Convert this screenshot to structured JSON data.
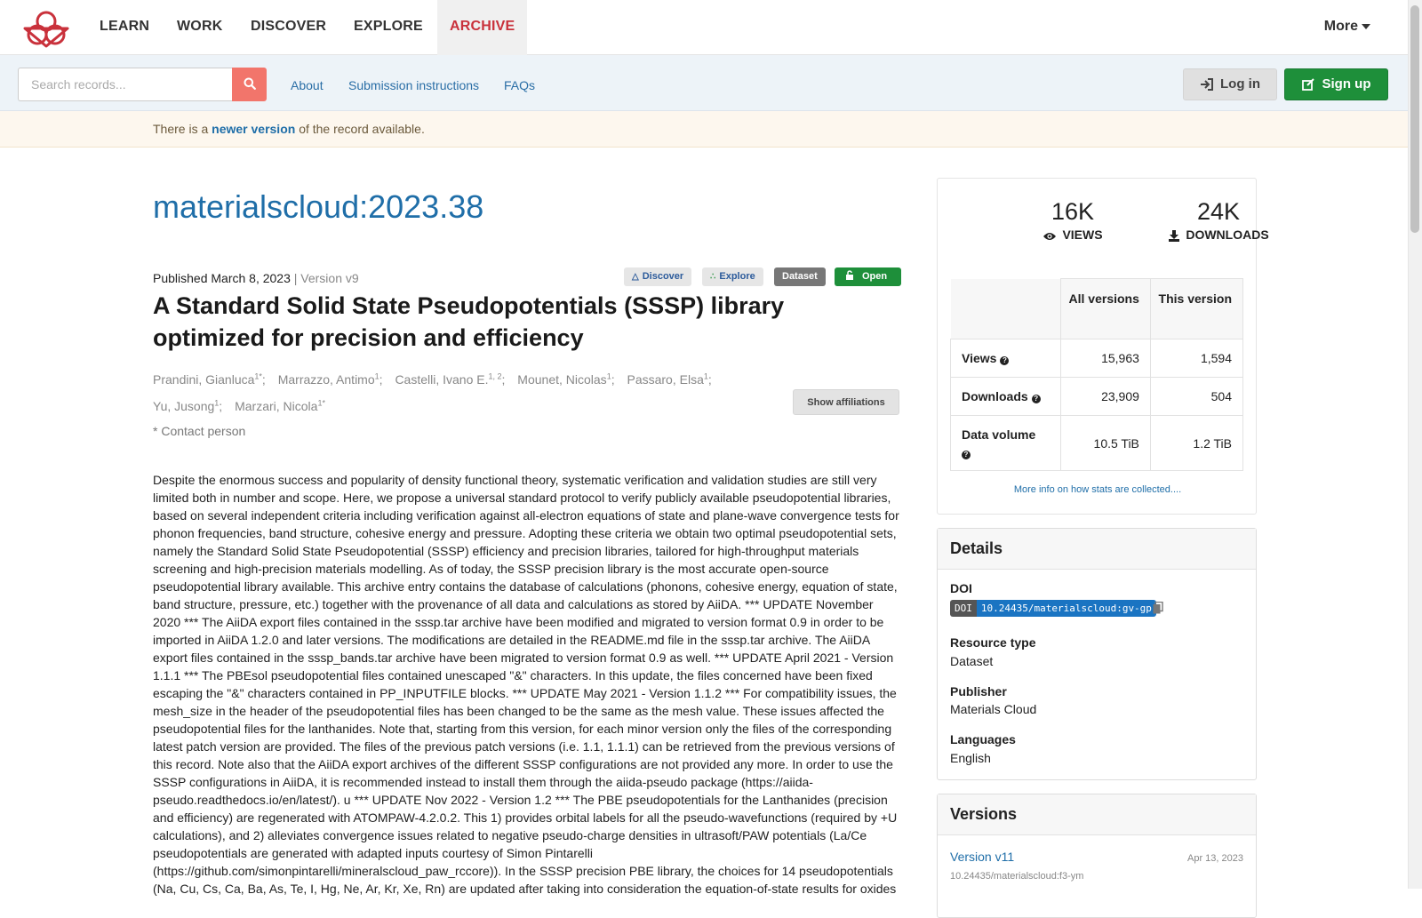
{
  "nav": {
    "items": [
      {
        "label": "LEARN"
      },
      {
        "label": "WORK"
      },
      {
        "label": "DISCOVER"
      },
      {
        "label": "EXPLORE"
      },
      {
        "label": "ARCHIVE"
      }
    ],
    "active": "ARCHIVE",
    "more_label": "More",
    "accent_color": "#c9313b"
  },
  "subbar": {
    "search_placeholder": "Search records...",
    "links": [
      "About",
      "Submission instructions",
      "FAQs"
    ],
    "login_label": "Log in",
    "signup_label": "Sign up"
  },
  "notice": {
    "prefix": "There is a",
    "link": "newer version",
    "suffix": "of the record available."
  },
  "record": {
    "id": "materialscloud:2023.38",
    "published_label": "Published March 8, 2023",
    "version_label": "| Version v9",
    "badges": {
      "discover": "Discover",
      "explore": "Explore",
      "dataset": "Dataset",
      "open": "Open"
    },
    "title": "A Standard Solid State Pseudopotentials (SSSP) library optimized for precision and efficiency",
    "authors": [
      {
        "name": "Prandini, Gianluca",
        "aff": "1*"
      },
      {
        "name": "Marrazzo, Antimo",
        "aff": "1"
      },
      {
        "name": "Castelli, Ivano E.",
        "aff": "1, 2"
      },
      {
        "name": "Mounet, Nicolas",
        "aff": "1"
      },
      {
        "name": "Passaro, Elsa",
        "aff": "1"
      },
      {
        "name": "Yu, Jusong",
        "aff": "1"
      },
      {
        "name": "Marzari, Nicola",
        "aff": "1*"
      }
    ],
    "show_affiliations_label": "Show affiliations",
    "contact_note": "* Contact person",
    "abstract": "Despite the enormous success and popularity of density functional theory, systematic verification and validation studies are still very limited both in number and scope. Here, we propose a universal standard protocol to verify publicly available pseudopotential libraries, based on several independent criteria including verification against all-electron equations of state and plane-wave convergence tests for phonon frequencies, band structure, cohesive energy and pressure. Adopting these criteria we obtain two optimal pseudopotential sets, namely the Standard Solid State Pseudopotential (SSSP) efficiency and precision libraries, tailored for high-throughput materials screening and high-precision materials modelling. As of today, the SSSP precision library is the most accurate open-source pseudopotential library available. This archive entry contains the database of calculations (phonons, cohesive energy, equation of state, band structure, pressure, etc.) together with the provenance of all data and calculations as stored by AiiDA. *** UPDATE November 2020 *** The AiiDA export files contained in the sssp.tar archive have been modified and migrated to version format 0.9 in order to be imported in AiiDA 1.2.0 and later versions. The modifications are detailed in the README.md file in the sssp.tar archive. The AiiDA export files contained in the sssp_bands.tar archive have been migrated to version format 0.9 as well. *** UPDATE April 2021 - Version 1.1.1 *** The PBEsol pseudopotential files contained unescaped \"&\" characters. In this update, the files concerned have been fixed escaping the \"&\" characters contained in PP_INPUTFILE blocks. *** UPDATE May 2021 - Version 1.1.2 *** For compatibility issues, the mesh_size in the header of the pseudopotential files has been changed to be the same as the mesh value. These issues affected the pseudopotential files for the lanthanides. Note that, starting from this version, for each minor version only the files of the corresponding latest patch version are provided. The files of the previous patch versions (i.e. 1.1, 1.1.1) can be retrieved from the previous versions of this record. Note also that the AiiDA export archives of the different SSSP configurations are not provided any more. In order to use the SSSP configurations in AiiDA, it is recommended instead to install them through the aiida-pseudo package (https://aiida-pseudo.readthedocs.io/en/latest/). u *** UPDATE Nov 2022 - Version 1.2 *** The PBE pseudopotentials for the Lanthanides (precision and efficiency) are regenerated with ATOMPAW-4.2.0.2. This 1) provides orbital labels for all the pseudo-wavefunctions (required by +U calculations), and 2) alleviates convergence issues related to negative pseudo-charge densities in ultrasoft/PAW potentials (La/Ce pseudopotentials are generated with adapted inputs courtesy of Simon Pintarelli (https://github.com/simonpintarelli/mineralscloud_paw_rccore)). In the SSSP precision PBE library, the choices for 14 pseudopotentials (Na, Cu, Cs, Ca, Ba, As, Te, I, Hg, Ne, Ar, Kr, Xe, Rn) are updated after taking into consideration the equation-of-state results for oxides"
  },
  "stats": {
    "views_big": "16K",
    "views_label": "VIEWS",
    "downloads_big": "24K",
    "downloads_label": "DOWNLOADS",
    "col_all": "All versions",
    "col_this": "This version",
    "rows": [
      {
        "label": "Views",
        "all": "15,963",
        "this": "1,594"
      },
      {
        "label": "Downloads",
        "all": "23,909",
        "this": "504"
      },
      {
        "label": "Data volume",
        "all": "10.5 TiB",
        "this": "1.2 TiB"
      }
    ],
    "more_info": "More info on how stats are collected...."
  },
  "details": {
    "heading": "Details",
    "doi_label": "DOI",
    "doi_badge_left": "DOI",
    "doi_value": "10.24435/materialscloud:gv-gp",
    "resource_type_label": "Resource type",
    "resource_type": "Dataset",
    "publisher_label": "Publisher",
    "publisher": "Materials Cloud",
    "languages_label": "Languages",
    "languages": "English"
  },
  "versions": {
    "heading": "Versions",
    "items": [
      {
        "label": "Version v11",
        "date": "Apr 13, 2023",
        "doi": "10.24435/materialscloud:f3-ym"
      }
    ]
  }
}
